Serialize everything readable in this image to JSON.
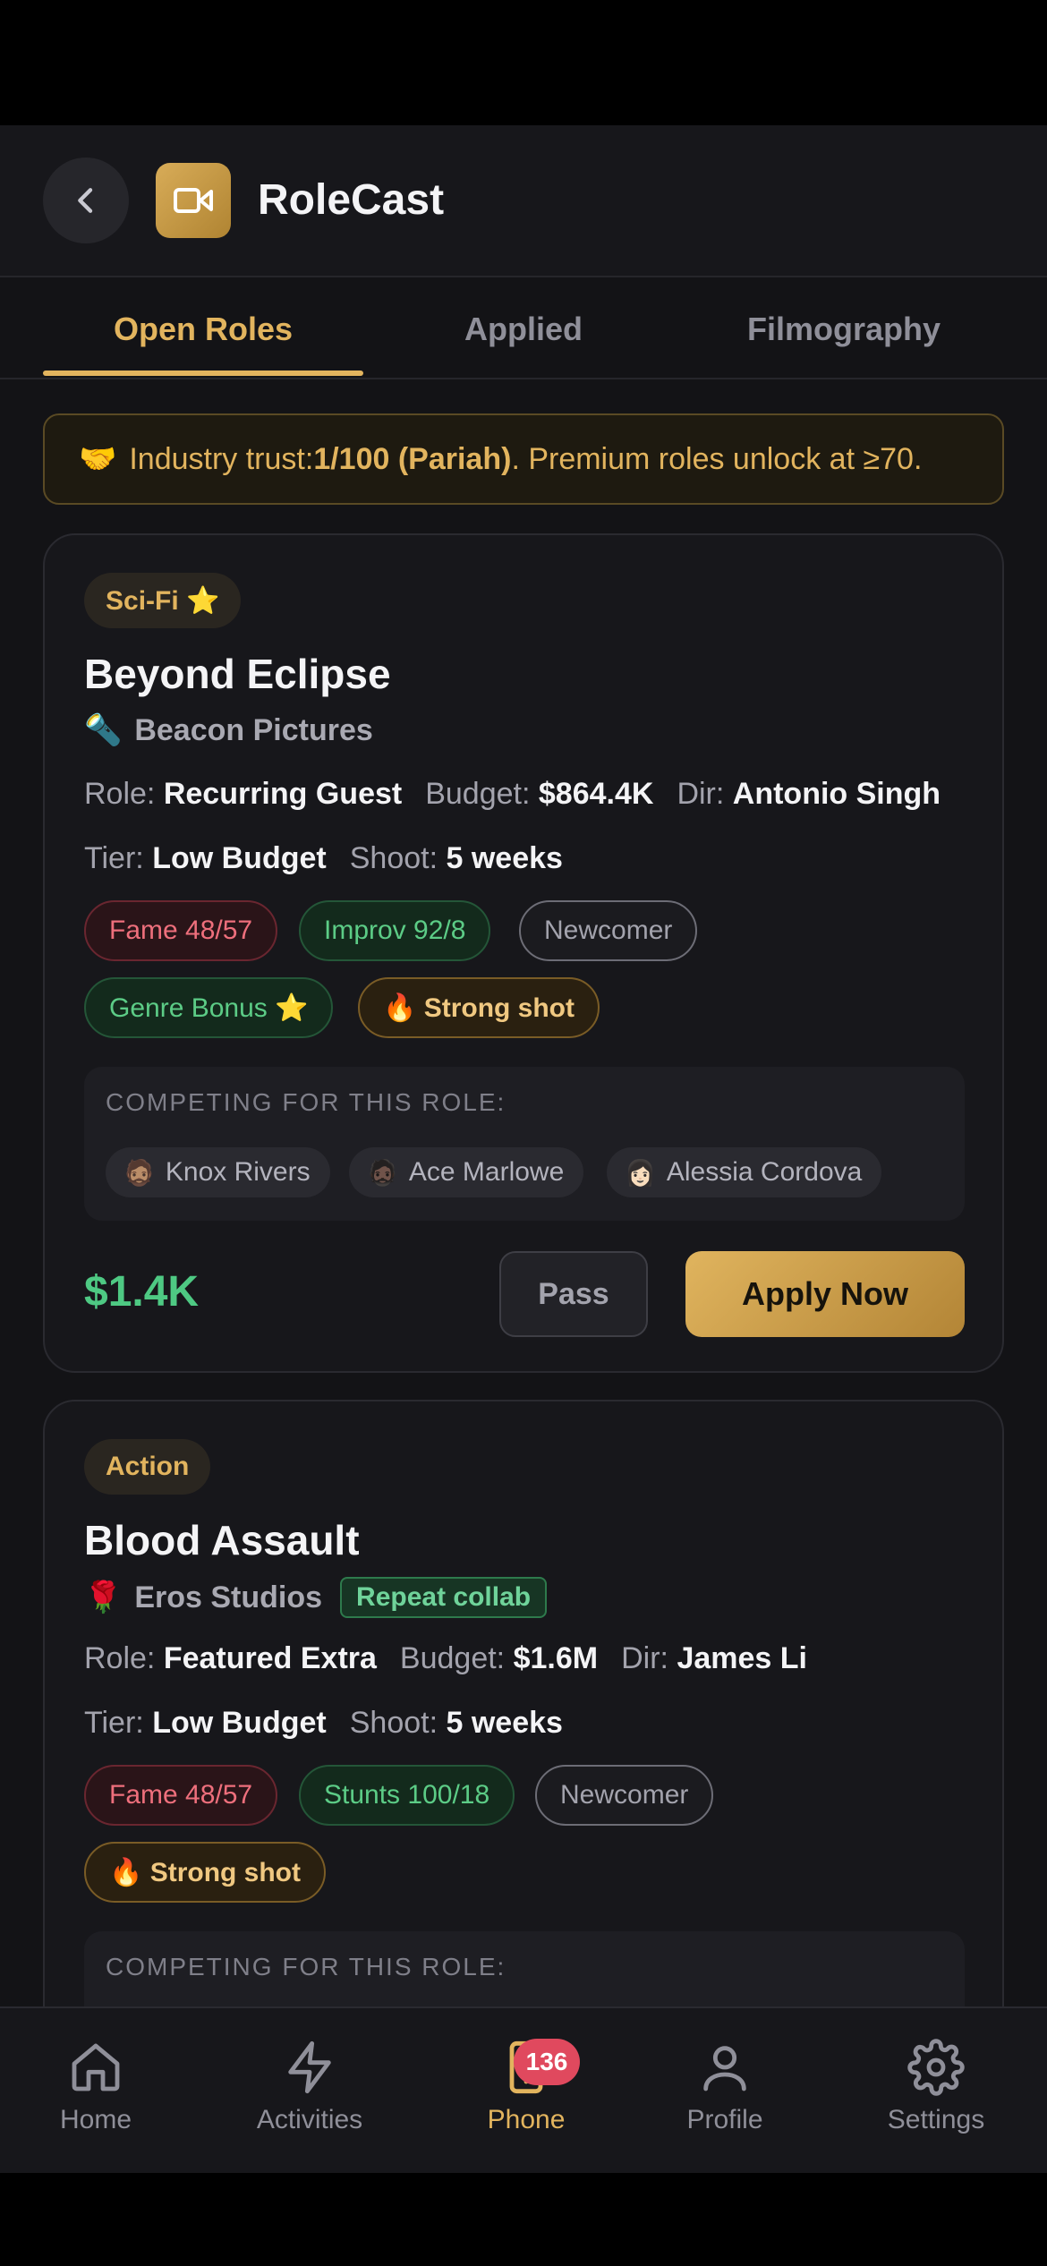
{
  "header": {
    "title": "RoleCast",
    "back_icon": "chevron-left-icon",
    "app_icon": "video-camera-icon"
  },
  "tabs": [
    {
      "label": "Open Roles",
      "active": true
    },
    {
      "label": "Applied",
      "active": false
    },
    {
      "label": "Filmography",
      "active": false
    }
  ],
  "trust_banner": {
    "emoji": "🤝",
    "prefix": "Industry trust: ",
    "value": "1/100 (Pariah)",
    "suffix": ". Premium roles unlock at ≥70."
  },
  "cards": [
    {
      "genre": "Sci-Fi ⭐",
      "title": "Beyond Eclipse",
      "studio_emoji": "🔦",
      "studio": "Beacon Pictures",
      "role_label": "Role:",
      "role": "Recurring Guest",
      "budget_label": "Budget:",
      "budget": "$864.4K",
      "dir_label": "Dir:",
      "dir": "Antonio Singh",
      "tier_label": "Tier:",
      "tier": "Low Budget",
      "shoot_label": "Shoot:",
      "shoot": "5 weeks",
      "chips": [
        "Fame 48/57",
        "Improv 92/8",
        "Newcomer",
        "Genre Bonus ⭐",
        "🔥 Strong shot"
      ],
      "compete_label": "COMPETING FOR THIS ROLE:",
      "competitors": [
        {
          "emoji": "🧔🏽",
          "name": "Knox Rivers"
        },
        {
          "emoji": "🧔🏿",
          "name": "Ace Marlowe"
        },
        {
          "emoji": "👩🏻",
          "name": "Alessia Cordova"
        }
      ],
      "pay": "$1.4K",
      "pass_label": "Pass",
      "apply_label": "Apply Now"
    },
    {
      "genre": "Action",
      "title": "Blood Assault",
      "studio_emoji": "🌹",
      "studio": "Eros Studios",
      "collab": "Repeat collab",
      "role_label": "Role:",
      "role": "Featured Extra",
      "budget_label": "Budget:",
      "budget": "$1.6M",
      "dir_label": "Dir:",
      "dir": "James Li",
      "tier_label": "Tier:",
      "tier": "Low Budget",
      "shoot_label": "Shoot:",
      "shoot": "5 weeks",
      "chips": [
        "Fame 48/57",
        "Stunts 100/18",
        "Newcomer",
        "🔥 Strong shot"
      ],
      "compete_label": "COMPETING FOR THIS ROLE:"
    }
  ],
  "nav": [
    {
      "label": "Home",
      "icon": "home-icon"
    },
    {
      "label": "Activities",
      "icon": "lightning-icon"
    },
    {
      "label": "Phone",
      "icon": "phone-icon",
      "badge": "136",
      "active": true
    },
    {
      "label": "Profile",
      "icon": "user-icon"
    },
    {
      "label": "Settings",
      "icon": "gear-icon"
    }
  ],
  "colors": {
    "accent": "#e2b45e",
    "background": "#131316",
    "pay_green": "#4ec983",
    "badge_red": "#e0495e"
  }
}
